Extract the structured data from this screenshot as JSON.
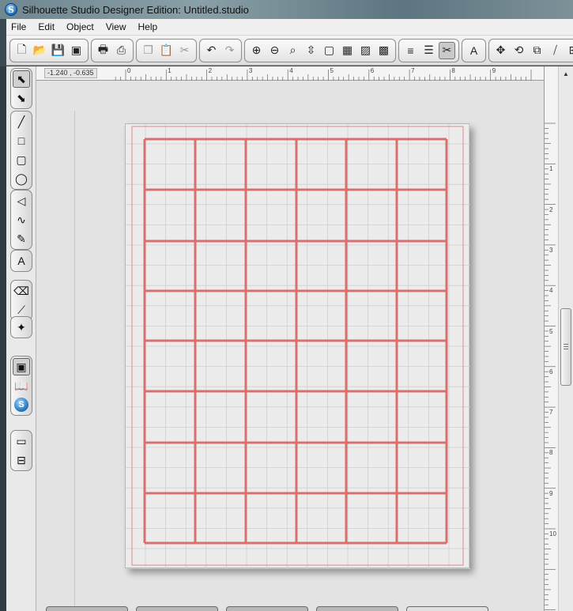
{
  "window": {
    "title": "Silhouette Studio Designer Edition: Untitled.studio",
    "logo_letter": "S"
  },
  "menu": [
    "File",
    "Edit",
    "Object",
    "View",
    "Help"
  ],
  "toolbar": {
    "groups": [
      [
        {
          "name": "new-document-icon",
          "glyph": "🗋"
        },
        {
          "name": "open-folder-icon",
          "glyph": "📂"
        },
        {
          "name": "save-icon",
          "glyph": "💾"
        },
        {
          "name": "save-to-library-icon",
          "glyph": "▣"
        }
      ],
      [
        {
          "name": "print-icon",
          "glyph": "🖶"
        },
        {
          "name": "print-cut-icon",
          "glyph": "⎙"
        }
      ],
      [
        {
          "name": "copy-icon",
          "glyph": "❐",
          "muted": true
        },
        {
          "name": "paste-icon",
          "glyph": "📋"
        },
        {
          "name": "cut-icon",
          "glyph": "✂",
          "muted": true
        }
      ],
      [
        {
          "name": "undo-icon",
          "glyph": "↶"
        },
        {
          "name": "redo-icon",
          "glyph": "↷",
          "muted": true
        }
      ],
      [
        {
          "name": "zoom-in-icon",
          "glyph": "⊕"
        },
        {
          "name": "zoom-out-icon",
          "glyph": "⊖"
        },
        {
          "name": "zoom-selection-icon",
          "glyph": "⌕"
        },
        {
          "name": "pan-icon",
          "glyph": "⇳"
        },
        {
          "name": "fit-to-page-icon",
          "glyph": "▢"
        },
        {
          "name": "grid-icon",
          "glyph": "▦"
        },
        {
          "name": "hatch-fill-icon",
          "glyph": "▨"
        },
        {
          "name": "registration-marks-icon",
          "glyph": "▩"
        }
      ],
      [
        {
          "name": "line-color-icon",
          "glyph": "≡"
        },
        {
          "name": "line-style-icon",
          "glyph": "☰"
        },
        {
          "name": "cut-settings-icon",
          "glyph": "✂",
          "active": true
        }
      ],
      [
        {
          "name": "text-style-icon",
          "glyph": "A"
        }
      ],
      [
        {
          "name": "move-icon",
          "glyph": "✥"
        },
        {
          "name": "rotate-icon",
          "glyph": "⟲"
        },
        {
          "name": "scale-icon",
          "glyph": "⧉"
        },
        {
          "name": "shear-icon",
          "glyph": "⧸"
        },
        {
          "name": "replicate-icon",
          "glyph": "⊞"
        }
      ]
    ]
  },
  "palette": {
    "groups": [
      [
        {
          "name": "select-tool-icon",
          "glyph": "⬉",
          "active": true
        },
        {
          "name": "edit-points-tool-icon",
          "glyph": "⬊"
        }
      ],
      [
        {
          "name": "line-tool-icon",
          "glyph": "╱"
        },
        {
          "name": "rectangle-tool-icon",
          "glyph": "□"
        },
        {
          "name": "rounded-rectangle-tool-icon",
          "glyph": "▢"
        },
        {
          "name": "ellipse-tool-icon",
          "glyph": "◯"
        }
      ],
      [
        {
          "name": "polygon-tool-icon",
          "glyph": "◁"
        },
        {
          "name": "curve-tool-icon",
          "glyph": "∿"
        },
        {
          "name": "freehand-tool-icon",
          "glyph": "✎"
        }
      ],
      [
        {
          "name": "text-tool-icon",
          "glyph": "A"
        }
      ],
      [
        {
          "name": "eraser-tool-icon",
          "glyph": "⌫"
        },
        {
          "name": "knife-tool-icon",
          "glyph": "⟋"
        }
      ],
      [
        {
          "name": "trace-tool-icon",
          "glyph": "✦"
        }
      ],
      [
        {
          "name": "page-setup-icon",
          "glyph": "▣",
          "active": true
        },
        {
          "name": "library-icon",
          "glyph": "📖"
        },
        {
          "name": "online-store-icon",
          "glyph": "S"
        }
      ],
      [
        {
          "name": "panel-layout-single-icon",
          "glyph": "▭"
        },
        {
          "name": "panel-layout-split-icon",
          "glyph": "⊟"
        }
      ]
    ]
  },
  "ruler": {
    "coords": "-1.240 , -0.635",
    "top_numbers": [
      "0",
      "1",
      "2",
      "3",
      "4",
      "5",
      "6",
      "7",
      "8",
      "9"
    ],
    "side_numbers": [
      "1",
      "2",
      "3",
      "4",
      "5",
      "6",
      "7",
      "8",
      "9",
      "10"
    ]
  },
  "page": {
    "grid_columns": 6,
    "grid_rows": 8,
    "grid_color": "#d9706f",
    "margin_color": "#d98a8a"
  }
}
